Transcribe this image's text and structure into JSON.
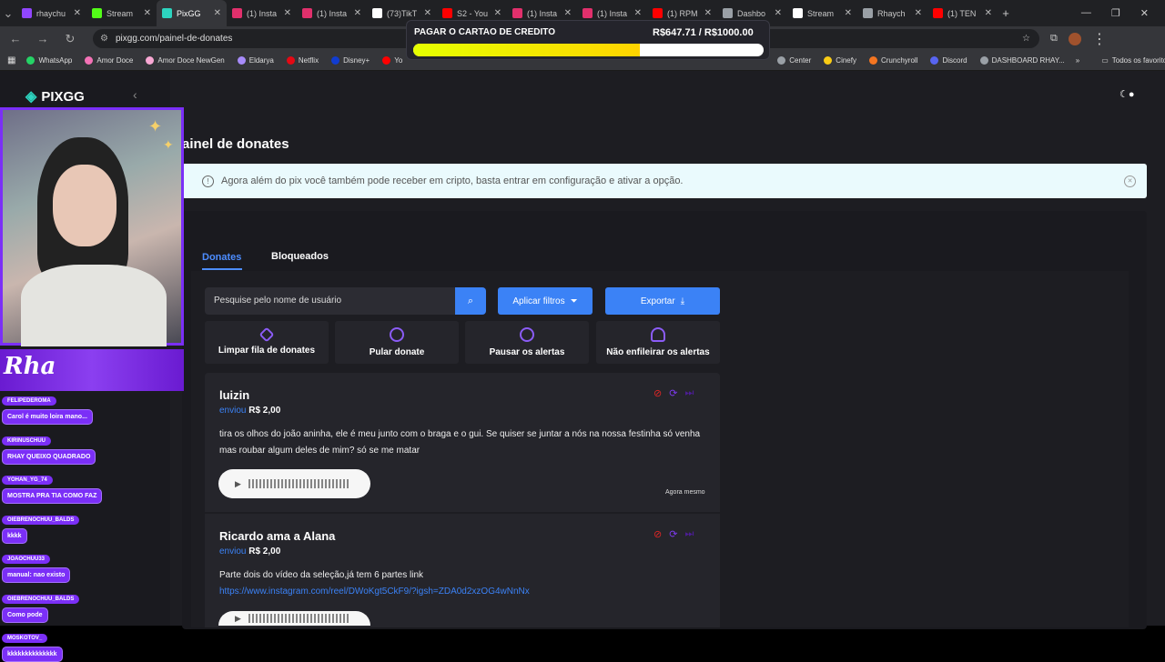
{
  "browser": {
    "tabs": [
      {
        "title": "rhaychu",
        "color": "#9146ff"
      },
      {
        "title": "Stream",
        "color": "#53fc18"
      },
      {
        "title": "PixGG",
        "color": "#2dd4bf"
      },
      {
        "title": "(1) Insta",
        "color": "#e1306c"
      },
      {
        "title": "(1) Insta",
        "color": "#e1306c"
      },
      {
        "title": "(73)TikT",
        "color": "#ffffff"
      },
      {
        "title": "S2 - You",
        "color": "#ff0000"
      },
      {
        "title": "(1) Insta",
        "color": "#e1306c"
      },
      {
        "title": "(1) Insta",
        "color": "#e1306c"
      },
      {
        "title": "(1) RPM",
        "color": "#ff0000"
      },
      {
        "title": "Dashbo",
        "color": "#9aa0a6"
      },
      {
        "title": "Stream",
        "color": "#ffffff"
      },
      {
        "title": "Rhaych",
        "color": "#9aa0a6"
      },
      {
        "title": "(1) TEN",
        "color": "#ff0000"
      }
    ],
    "url": "pixgg.com/painel-de-donates",
    "bookmarks": [
      {
        "label": "WhatsApp",
        "color": "#25d366"
      },
      {
        "label": "Amor Doce",
        "color": "#f472b6"
      },
      {
        "label": "Amor Doce NewGen",
        "color": "#f9a8d4"
      },
      {
        "label": "Eldarya",
        "color": "#a78bfa"
      },
      {
        "label": "Netflix",
        "color": "#e50914"
      },
      {
        "label": "Disney+",
        "color": "#113ccf"
      },
      {
        "label": "Yo",
        "color": "#ff0000"
      }
    ],
    "bookmarks_right": [
      {
        "label": "Center",
        "color": "#9aa0a6"
      },
      {
        "label": "Cinefy",
        "color": "#facc15"
      },
      {
        "label": "Crunchyroll",
        "color": "#f47521"
      },
      {
        "label": "Discord",
        "color": "#5865f2"
      },
      {
        "label": "DASHBOARD RHAY...",
        "color": "#9aa0a6"
      }
    ],
    "all_favorites": "Todos os favoritos"
  },
  "goal": {
    "label": "PAGAR O CARTAO DE CREDITO",
    "amount": "R$647.71 / R$1000.00",
    "progress": 0.648
  },
  "app": {
    "logo": "PIXGG",
    "page_title": "ainel de donates",
    "notice": "Agora além do pix você também pode receber em cripto, basta entrar em configuração e ativar a opção.",
    "tabs": {
      "donates": "Donates",
      "bloqueados": "Bloqueados"
    },
    "search_placeholder": "Pesquise pelo nome de usuário",
    "filter_label": "Aplicar filtros",
    "export_label": "Exportar",
    "actions": {
      "clear": "Limpar fila de donates",
      "skip": "Pular donate",
      "pause": "Pausar os alertas",
      "no_queue": "Não enfileirar os alertas"
    },
    "donations": [
      {
        "name": "luizin",
        "sent_prefix": "enviou",
        "amount": "R$ 2,00",
        "message": "tira os olhos do joão aninha, ele é meu junto com o braga e o gui. Se quiser se juntar a nós na nossa festinha só venha mas roubar algum deles de mim? só se me matar",
        "time": "Agora mesmo"
      },
      {
        "name": "Ricardo ama a Alana",
        "sent_prefix": "enviou",
        "amount": "R$ 2,00",
        "message": "Parte dois do vídeo da seleção,já tem 6 partes link",
        "link": "https://www.instagram.com/reel/DWoKgt5CkF9/?igsh=ZDA0d2xzOG4wNnNx"
      }
    ]
  },
  "stream_overlay": {
    "banner": "Rha",
    "chat": [
      {
        "user": "FELIPEDEROMA",
        "message": "Carol é muito loira mano..."
      },
      {
        "user": "KIRINUSCHUU",
        "message": "RHAY QUEIXO QUADRADO"
      },
      {
        "user": "YOHAN_YG_74",
        "message": "MOSTRA PRA TIA COMO FAZ"
      },
      {
        "user": "OIEBRENOCHUU_BALDS",
        "message": "kkkk"
      },
      {
        "user": "JOAOCHUU33",
        "message": "manual: nao existo"
      },
      {
        "user": "OIEBRENOCHUU_BALDS",
        "message": "Como pode"
      },
      {
        "user": "MOSKOTOV_",
        "message": "kkkkkkkkkkkkkk"
      }
    ]
  }
}
